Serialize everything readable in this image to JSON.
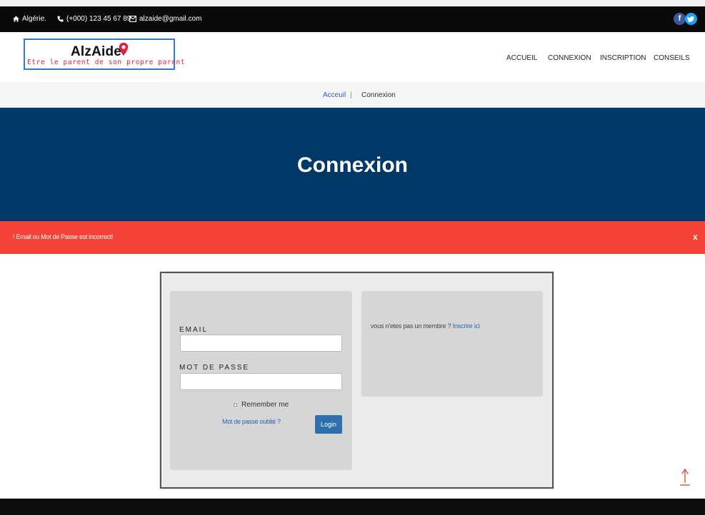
{
  "topbar": {
    "location": "Algérie.",
    "phone": "(+000) 123 45 67 89",
    "email": "alzaide@gmail.com",
    "social": [
      {
        "icon": "facebook-icon",
        "glyph": "f",
        "color": "#3b5998"
      },
      {
        "icon": "twitter-icon",
        "glyph": "t",
        "color": "#1da1f2"
      }
    ]
  },
  "logo": {
    "title": "AlzAide",
    "tagline": "Etre le parent de son propre parent",
    "border_color": "#2f7ad8",
    "tagline_color": "#e0203a"
  },
  "nav": {
    "items": [
      "ACCUEIL",
      "CONNEXION",
      "INSCRIPTION",
      "CONSEILS"
    ]
  },
  "breadcrumb": {
    "home": "Acceuil",
    "separator": "|",
    "current": "Connexion"
  },
  "hero": {
    "title": "Connexion",
    "background": "#003867"
  },
  "alert": {
    "message": "! Email ou Mot de Passe est incorrect!",
    "close": "x",
    "background": "#f44336"
  },
  "login": {
    "email_label": "EMAIL",
    "email_value": "",
    "password_label": "MOT DE PASSE",
    "password_value": "",
    "remember_label": "Remember me",
    "remember_checked": false,
    "forgot_link": "Mot de passe oublié ?",
    "submit_label": "Login"
  },
  "register": {
    "prompt": "vous n'etes pas un membre ?",
    "link": "Inscrire ici"
  },
  "scroll_top": {
    "icon": "arrow-up-icon",
    "color": "#e74c3c"
  }
}
